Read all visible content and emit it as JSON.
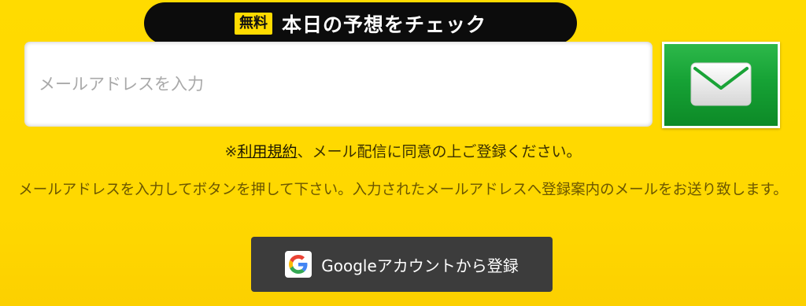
{
  "banner": {
    "badge": "無料",
    "title": "本日の予想をチェック"
  },
  "email_form": {
    "placeholder": "メールアドレスを入力",
    "value": ""
  },
  "submit_button": {
    "icon": "mail-icon"
  },
  "terms": {
    "prefix": "※",
    "link_text": "利用規約",
    "suffix": "、メール配信に同意の上ご登録ください。"
  },
  "instructions": {
    "text": "メールアドレスを入力してボタンを押して下さい。入力されたメールアドレスへ登録案内のメールをお送り致します。"
  },
  "google_button": {
    "icon": "google-icon",
    "label": "Googleアカウントから登録"
  },
  "colors": {
    "background": "#ffdb00",
    "banner": "#0c0c0c",
    "submit_green": "#16a235",
    "google_button": "#3c3c3c"
  }
}
